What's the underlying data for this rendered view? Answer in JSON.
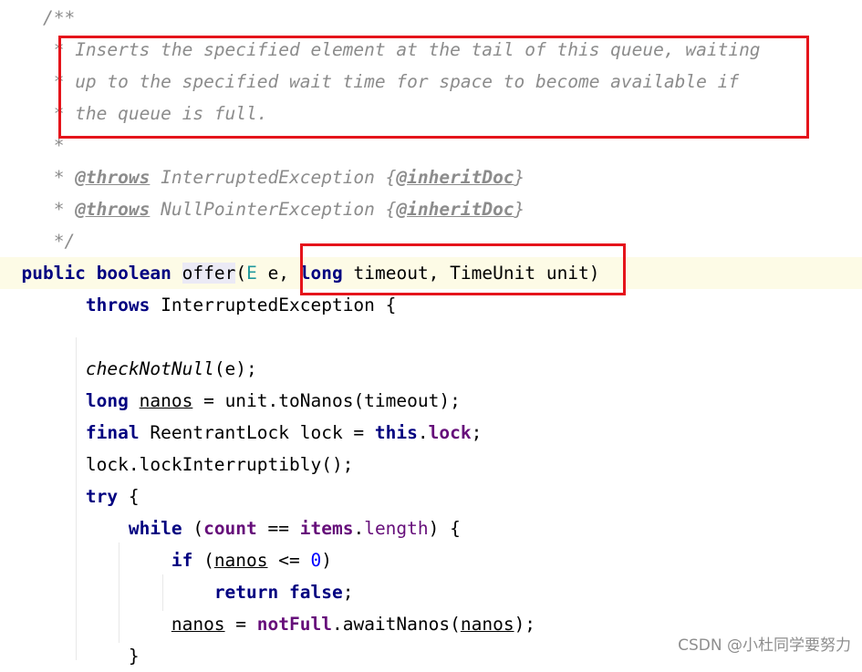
{
  "lines": [
    [
      {
        "t": "    /**",
        "c": "jd"
      }
    ],
    [
      {
        "t": "     * ",
        "c": "jd"
      },
      {
        "t": "Inserts the specified element at the tail of this queue, waiting",
        "c": "jd"
      }
    ],
    [
      {
        "t": "     * ",
        "c": "jd"
      },
      {
        "t": "up to the specified wait time for space to become available if",
        "c": "jd"
      }
    ],
    [
      {
        "t": "     * ",
        "c": "jd"
      },
      {
        "t": "the queue is full.",
        "c": "jd"
      }
    ],
    [
      {
        "t": "     *",
        "c": "jd"
      }
    ],
    [
      {
        "t": "     * ",
        "c": "jd"
      },
      {
        "t": "@throws",
        "c": "jd-tag"
      },
      {
        "t": " InterruptedException ",
        "c": "jd"
      },
      {
        "t": "{",
        "c": "jd"
      },
      {
        "t": "@inheritDoc",
        "c": "jd-tag"
      },
      {
        "t": "}",
        "c": "jd"
      }
    ],
    [
      {
        "t": "     * ",
        "c": "jd"
      },
      {
        "t": "@throws",
        "c": "jd-tag"
      },
      {
        "t": " NullPointerException ",
        "c": "jd"
      },
      {
        "t": "{",
        "c": "jd"
      },
      {
        "t": "@inheritDoc",
        "c": "jd-tag"
      },
      {
        "t": "}",
        "c": "jd"
      }
    ],
    [
      {
        "t": "     */",
        "c": "jd"
      }
    ],
    [
      {
        "t": "  ",
        "c": ""
      },
      {
        "t": "public",
        "c": "kw"
      },
      {
        "t": " ",
        "c": ""
      },
      {
        "t": "boolean",
        "c": "kw"
      },
      {
        "t": " ",
        "c": ""
      },
      {
        "t": "offer",
        "c": "decl"
      },
      {
        "t": "(",
        "c": ""
      },
      {
        "t": "E",
        "c": "tp"
      },
      {
        "t": " e, ",
        "c": ""
      },
      {
        "t": "long",
        "c": "kw"
      },
      {
        "t": " timeout, TimeUnit unit)",
        "c": ""
      }
    ],
    [
      {
        "t": "        ",
        "c": ""
      },
      {
        "t": "throws",
        "c": "kw"
      },
      {
        "t": " InterruptedException {",
        "c": ""
      }
    ],
    [],
    [
      {
        "t": "        ",
        "c": ""
      },
      {
        "t": "checkNotNull",
        "c": "it"
      },
      {
        "t": "(e);",
        "c": ""
      }
    ],
    [
      {
        "t": "        ",
        "c": ""
      },
      {
        "t": "long",
        "c": "kw"
      },
      {
        "t": " ",
        "c": ""
      },
      {
        "t": "nanos",
        "c": "ul"
      },
      {
        "t": " = unit.toNanos(timeout);",
        "c": ""
      }
    ],
    [
      {
        "t": "        ",
        "c": ""
      },
      {
        "t": "final",
        "c": "kw"
      },
      {
        "t": " ReentrantLock lock = ",
        "c": ""
      },
      {
        "t": "this",
        "c": "kw"
      },
      {
        "t": ".",
        "c": ""
      },
      {
        "t": "lock",
        "c": "fldb"
      },
      {
        "t": ";",
        "c": ""
      }
    ],
    [
      {
        "t": "        lock.lockInterruptibly();",
        "c": ""
      }
    ],
    [
      {
        "t": "        ",
        "c": ""
      },
      {
        "t": "try",
        "c": "kw"
      },
      {
        "t": " {",
        "c": ""
      }
    ],
    [
      {
        "t": "            ",
        "c": ""
      },
      {
        "t": "while",
        "c": "kw"
      },
      {
        "t": " (",
        "c": ""
      },
      {
        "t": "count",
        "c": "fldb"
      },
      {
        "t": " == ",
        "c": ""
      },
      {
        "t": "items",
        "c": "fldb"
      },
      {
        "t": ".",
        "c": ""
      },
      {
        "t": "length",
        "c": "fld"
      },
      {
        "t": ") {",
        "c": ""
      }
    ],
    [
      {
        "t": "                ",
        "c": ""
      },
      {
        "t": "if",
        "c": "kw"
      },
      {
        "t": " (",
        "c": ""
      },
      {
        "t": "nanos",
        "c": "ul"
      },
      {
        "t": " <= ",
        "c": ""
      },
      {
        "t": "0",
        "c": "num"
      },
      {
        "t": ")",
        "c": ""
      }
    ],
    [
      {
        "t": "                    ",
        "c": ""
      },
      {
        "t": "return",
        "c": "kw"
      },
      {
        "t": " ",
        "c": ""
      },
      {
        "t": "false",
        "c": "kw"
      },
      {
        "t": ";",
        "c": ""
      }
    ],
    [
      {
        "t": "                ",
        "c": ""
      },
      {
        "t": "nanos",
        "c": "ul"
      },
      {
        "t": " = ",
        "c": ""
      },
      {
        "t": "notFull",
        "c": "fldb"
      },
      {
        "t": ".awaitNanos(",
        "c": ""
      },
      {
        "t": "nanos",
        "c": "ul"
      },
      {
        "t": ");",
        "c": ""
      }
    ],
    [
      {
        "t": "            }",
        "c": ""
      }
    ]
  ],
  "highlighted_line": 8,
  "watermark": "CSDN @小杜同学要努力"
}
